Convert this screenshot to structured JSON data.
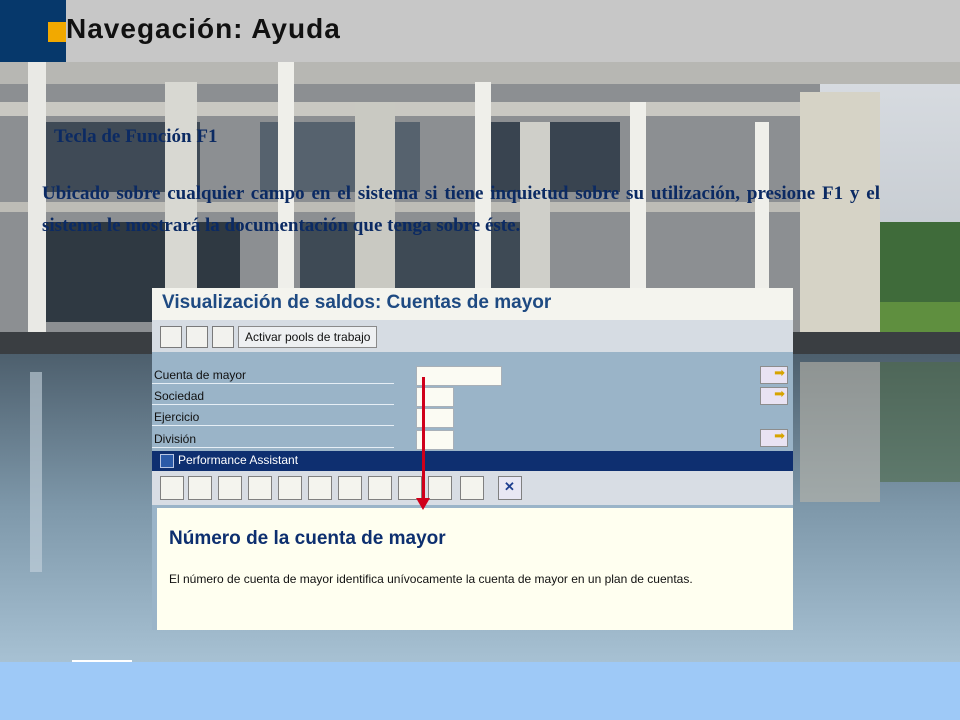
{
  "slide": {
    "title": "Navegación: Ayuda",
    "subtitle": "Tecla de Función F1",
    "paragraph": "Ubicado sobre cualquier campo en el sistema si tiene inquietud sobre su utilización, presione F1 y el sistema le mostrará la documentación que tenga sobre éste."
  },
  "sap_screen": {
    "title": "Visualización de saldos: Cuentas de mayor",
    "toolbar_button": "Activar pools de trabajo",
    "fields": [
      {
        "label": "Cuenta de mayor",
        "value": ""
      },
      {
        "label": "Sociedad",
        "value": ""
      },
      {
        "label": "Ejercicio",
        "value": ""
      },
      {
        "label": "División",
        "value": ""
      }
    ]
  },
  "performance_assistant": {
    "window_title": "Performance Assistant",
    "heading": "Número de la cuenta de mayor",
    "text": "El número de cuenta de mayor identifica unívocamente la cuenta de mayor en un plan de cuentas."
  },
  "colors": {
    "title_bar": "#c7c7c7",
    "corner_block": "#06386b",
    "accent_square": "#f2a900",
    "pa_bar": "#0e2f70",
    "arrow": "#d0001a",
    "text_blue": "#0b2a63"
  }
}
